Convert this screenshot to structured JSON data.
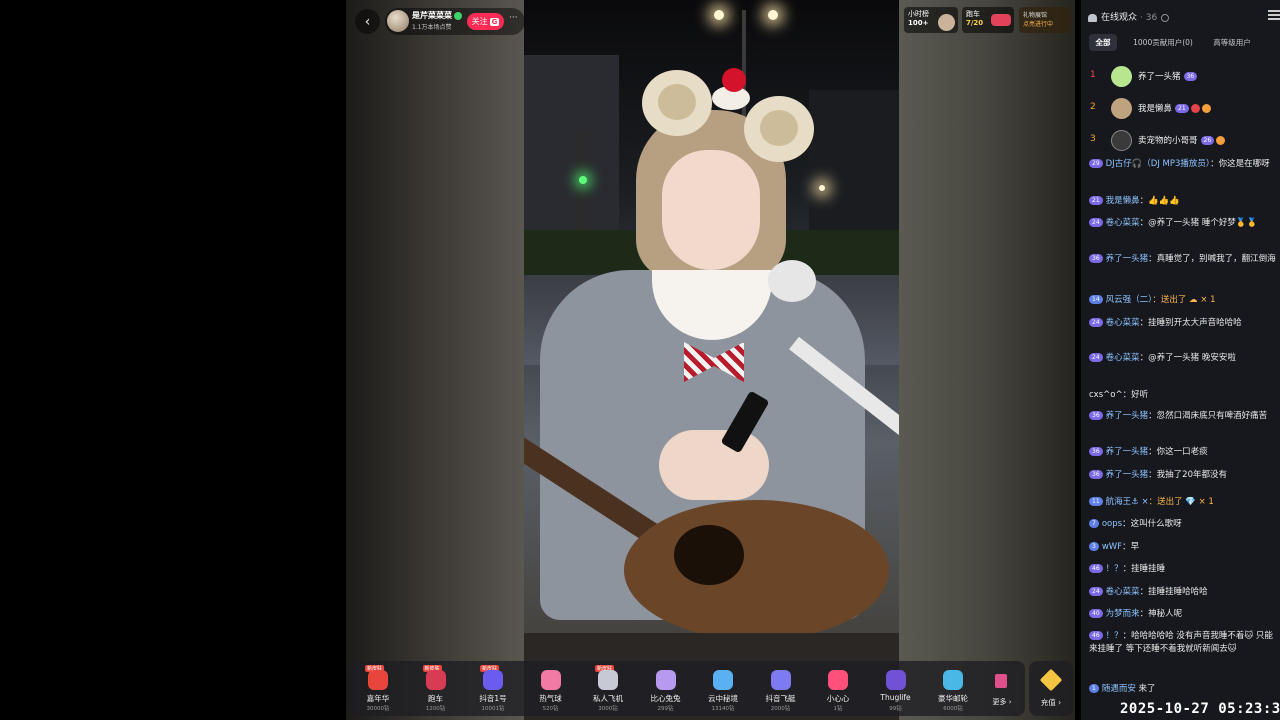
{
  "header": {
    "anchor_name": "是芹菜菜菜",
    "anchor_likes": "1.1万本场点赞",
    "follow_label": "关注",
    "follow_badge": "G",
    "more_label": "···"
  },
  "rank_cards": [
    {
      "title": "小时榜",
      "value": "100+"
    },
    {
      "title": "跑车",
      "value": "7/20"
    }
  ],
  "gift_status": {
    "title": "礼物展馆",
    "subtitle": "点亮进行中"
  },
  "gifts": [
    {
      "name": "嘉年华",
      "price": "30000钻",
      "badge": "新皮肤",
      "color": "#e8453c"
    },
    {
      "name": "跑车",
      "price": "1200钻",
      "badge": "新皮肤",
      "color": "#d93b52"
    },
    {
      "name": "抖音1号",
      "price": "10001钻",
      "badge": "新皮肤",
      "color": "#6b5cf0"
    },
    {
      "name": "热气球",
      "price": "520钻",
      "badge": "",
      "color": "#f07aa3"
    },
    {
      "name": "私人飞机",
      "price": "3000钻",
      "badge": "新皮肤",
      "color": "#c9c9d6"
    },
    {
      "name": "比心兔兔",
      "price": "299钻",
      "badge": "",
      "color": "#b79af0"
    },
    {
      "name": "云中秘境",
      "price": "13140钻",
      "badge": "",
      "color": "#5ab0f2"
    },
    {
      "name": "抖音飞艇",
      "price": "2000钻",
      "badge": "",
      "color": "#7e7bf0"
    },
    {
      "name": "小心心",
      "price": "1钻",
      "badge": "",
      "color": "#ff4f7b"
    },
    {
      "name": "Thuglife",
      "price": "99钻",
      "badge": "",
      "color": "#6f52d6"
    },
    {
      "name": "豪华邮轮",
      "price": "6000钻",
      "badge": "",
      "color": "#4bb7e6"
    }
  ],
  "more_label": "更多",
  "recharge_label": "充值",
  "panel": {
    "title": "在线观众",
    "count": "· 36",
    "tabs": [
      "全部",
      "1000贡献用户(0)",
      "高等级用户"
    ]
  },
  "top_viewers": [
    {
      "rank": "1",
      "name": "养了一头猪",
      "level": "36"
    },
    {
      "rank": "2",
      "name": "我是懒鼻",
      "level": "21"
    },
    {
      "rank": "3",
      "name": "卖宠物的小哥哥",
      "level": "26"
    }
  ],
  "chat": [
    {
      "level": "29",
      "user": "DJ古仔🎧（DJ MP3播放员）",
      "text": "：你这是在哪呀"
    },
    {
      "level": "21",
      "user": "我是懒鼻",
      "text": "：👍👍👍"
    },
    {
      "level": "24",
      "user": "卷心菜菜",
      "text": "：@养了一头猪 睡个好梦🥇🥇"
    },
    {
      "level": "36",
      "user": "养了一头猪",
      "text": "：真睡觉了，别喊我了，翻江倒海"
    },
    {
      "level": "14",
      "user": "风云强（二）",
      "text": "：送出了 ☁ × 1",
      "gift": true
    },
    {
      "level": "24",
      "user": "卷心菜菜",
      "text": "：挂睡别开太大声音哈哈哈"
    },
    {
      "level": "24",
      "user": "卷心菜菜",
      "text": "：@养了一头猪 晚安安啦"
    },
    {
      "level": "",
      "user": "",
      "text": "cxs^o^：好听"
    },
    {
      "level": "36",
      "user": "养了一头猪",
      "text": "：忽然口渴床底只有啤酒好痛苦"
    },
    {
      "level": "36",
      "user": "养了一头猪",
      "text": "：你这一口老痰"
    },
    {
      "level": "36",
      "user": "养了一头猪",
      "text": "：我抽了20年都没有"
    },
    {
      "level": "11",
      "user": "航海王⚓ ×",
      "text": "：送出了 💎 × 1",
      "gift": true
    },
    {
      "level": "7",
      "user": "oops",
      "text": "：这叫什么歌呀"
    },
    {
      "level": "3",
      "user": "wWF",
      "text": "：早"
    },
    {
      "level": "46",
      "user": "！？",
      "text": "：挂睡挂睡"
    },
    {
      "level": "24",
      "user": "卷心菜菜",
      "text": "：挂睡挂睡哈哈哈"
    },
    {
      "level": "40",
      "user": "为梦而来",
      "text": "：神秘人呢"
    },
    {
      "level": "46",
      "user": "！？",
      "text": "：哈哈哈哈哈 没有声音我睡不着🐱 只能来挂睡了 等下还睡不着我就听新闻去🐱"
    },
    {
      "level": "1",
      "user": "随遇而安",
      "text": " 来了"
    }
  ],
  "timestamp": "2025-10-27 05:23:30",
  "icons": [
    "back-icon",
    "verified-icon",
    "people-icon",
    "info-icon",
    "collapse-icon",
    "diamond-icon"
  ]
}
